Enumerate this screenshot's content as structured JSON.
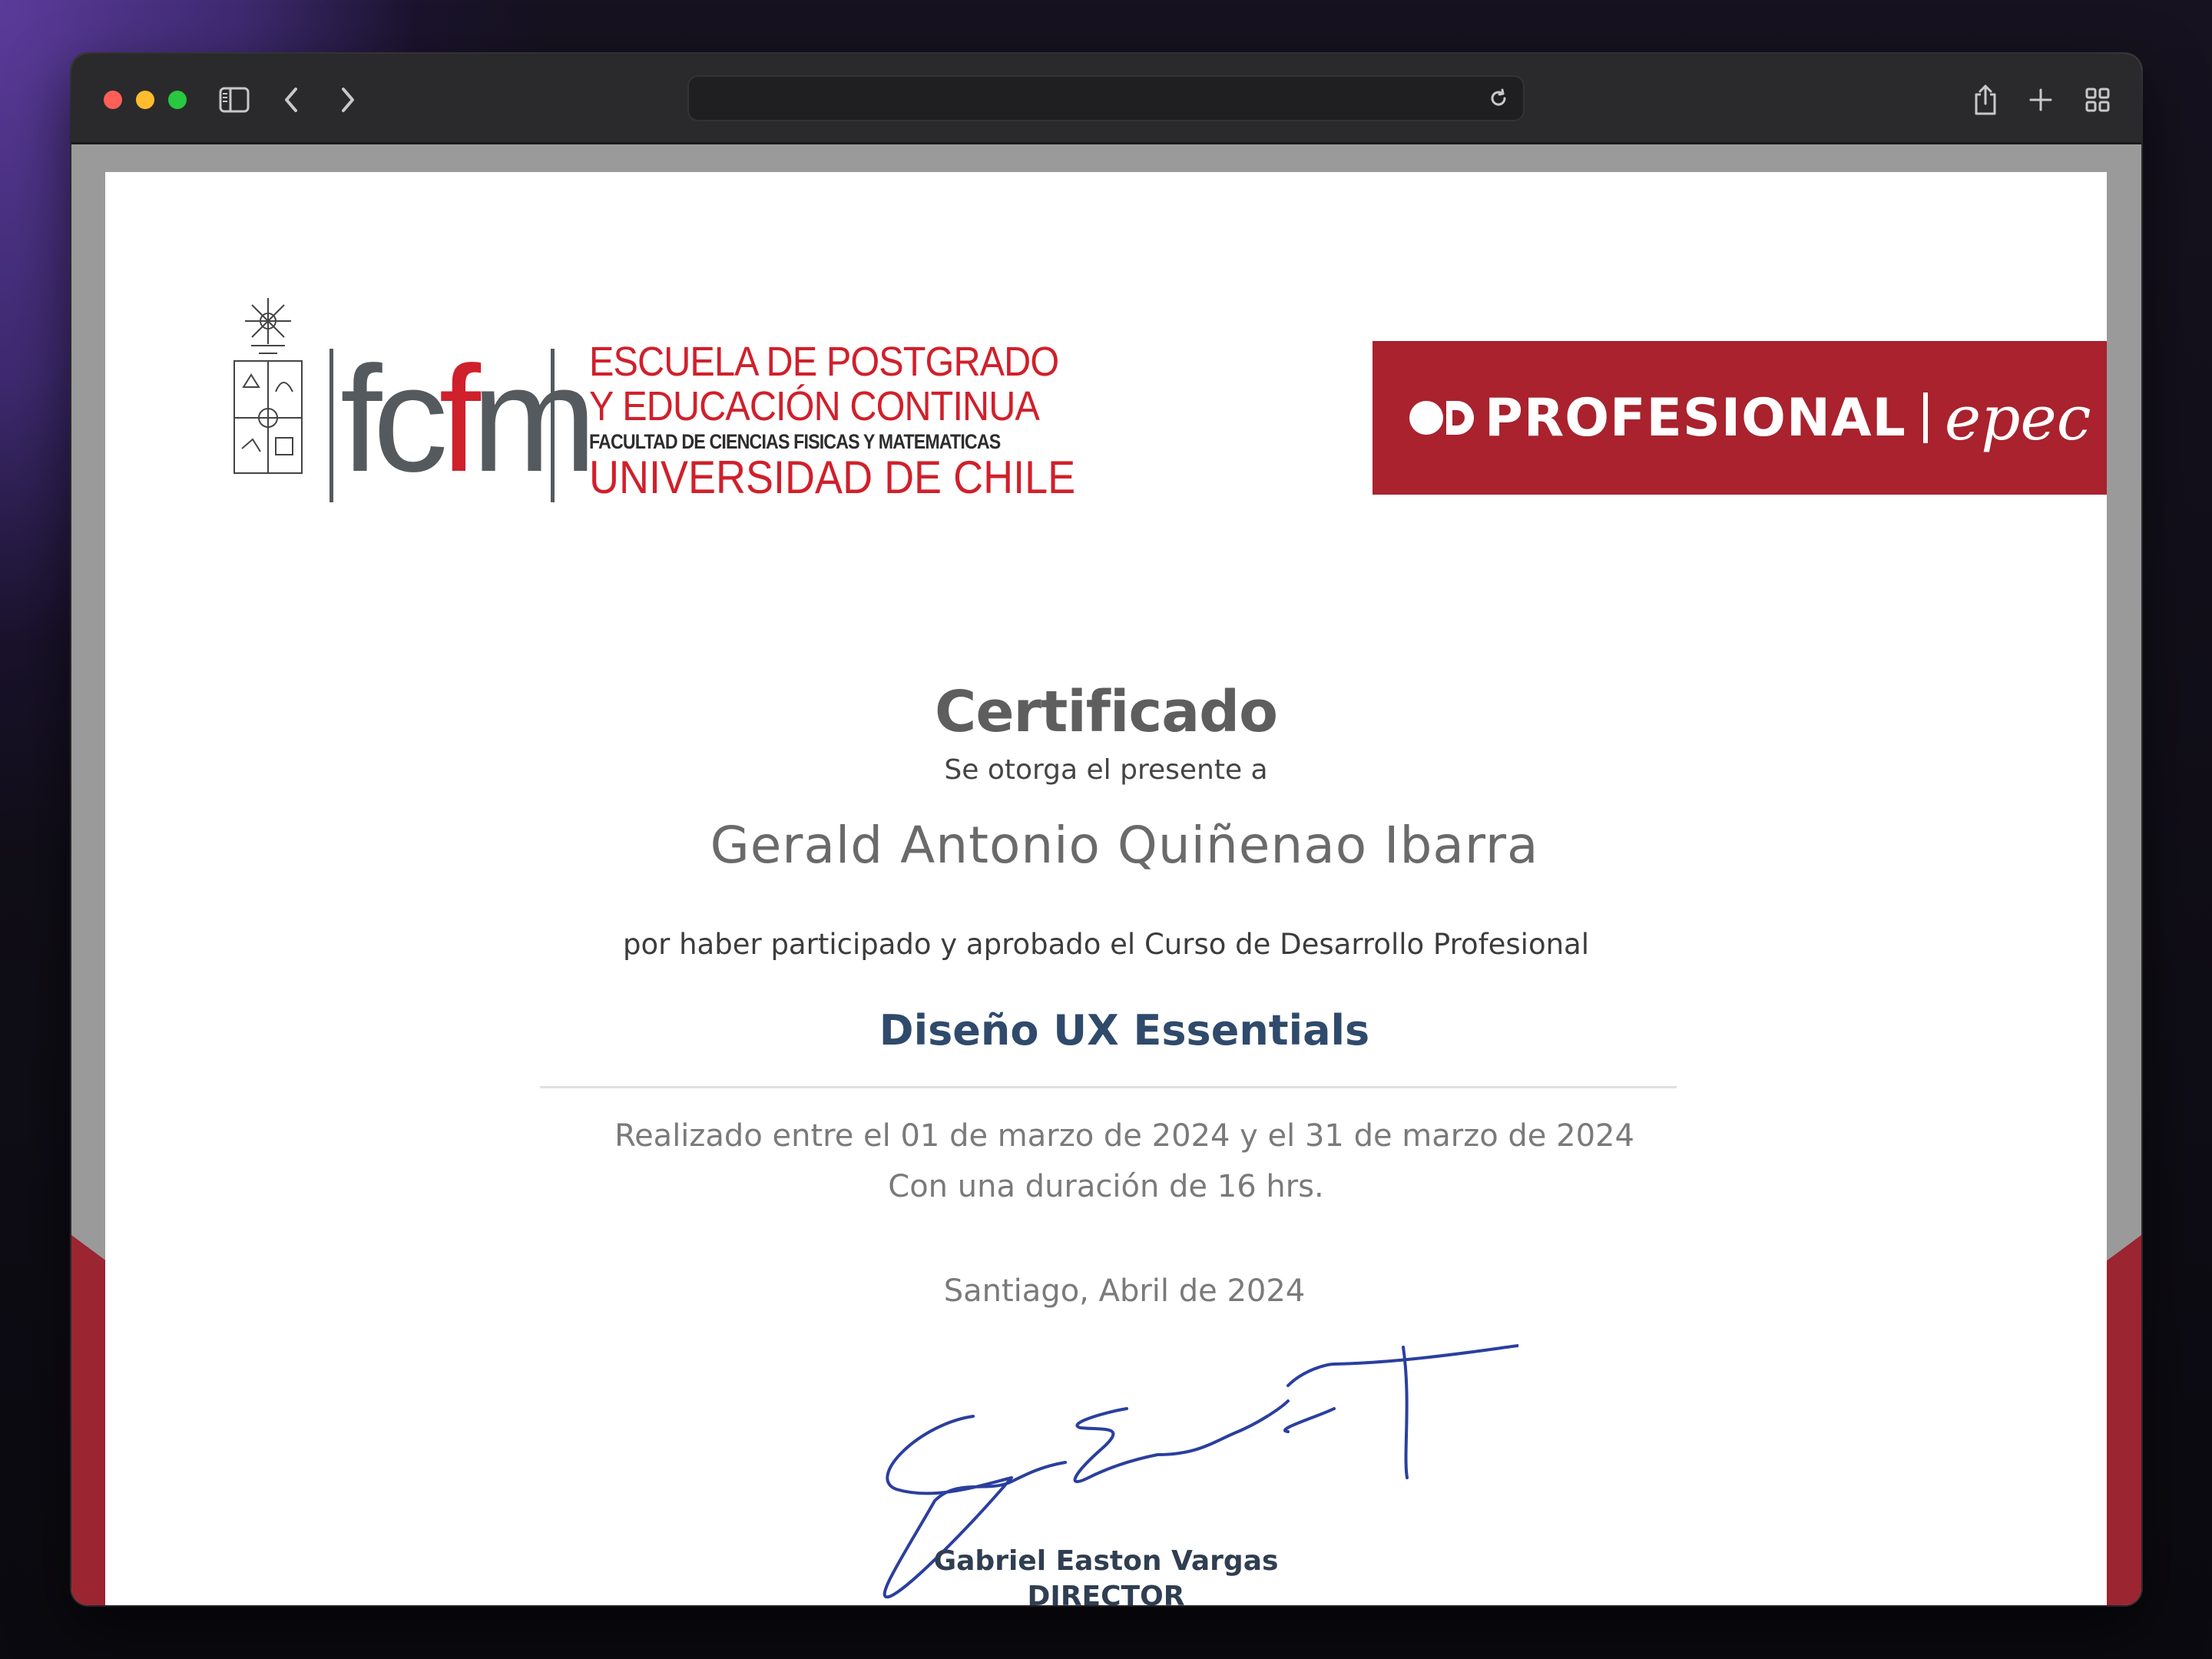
{
  "window": {
    "address": ""
  },
  "certificate": {
    "logo_left": {
      "wordmark_a": "fc",
      "wordmark_b": "f",
      "wordmark_c": "m",
      "line1": "ESCUELA DE POSTGRADO",
      "line2": "Y EDUCACIÓN CONTINUA",
      "line3": "FACULTAD DE CIENCIAS FISICAS Y MATEMATICAS",
      "line4": "UNIVERSIDAD DE CHILE"
    },
    "logo_right": {
      "text": "PROFESIONAL",
      "script": "epec",
      "color": "#a9222d"
    },
    "title": "Certificado",
    "subtitle": "Se otorga el presente a",
    "recipient": "Gerald Antonio Quiñenao Ibarra",
    "statement": "por haber participado y aprobado el Curso de Desarrollo Profesional",
    "course": "Diseño UX Essentials",
    "period": "Realizado entre el 01 de marzo de 2024 y el 31 de marzo de 2024",
    "duration": "Con una duración de 16 hrs.",
    "place_date": "Santiago, Abril de 2024",
    "signer_name": "Gabriel Easton Vargas",
    "signer_role": "DIRECTOR"
  },
  "icons": {
    "sidebar": "sidebar-icon",
    "back": "chevron-left-icon",
    "forward": "chevron-right-icon",
    "reload": "reload-icon",
    "share": "share-icon",
    "new_tab": "plus-icon",
    "tabs": "tab-overview-icon"
  }
}
